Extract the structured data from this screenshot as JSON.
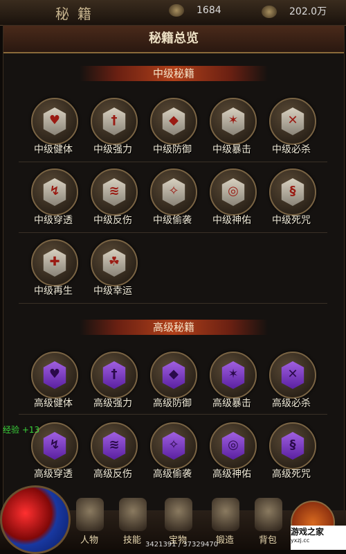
{
  "topbar": {
    "title": "秘籍",
    "resource1": "1684",
    "resource2": "202.0万"
  },
  "header": {
    "title": "秘籍总览"
  },
  "sections": {
    "mid": {
      "title": "中级秘籍"
    },
    "high": {
      "title": "高级秘籍"
    }
  },
  "mid_skills": [
    {
      "label": "中级健体",
      "icon": "heart-shield-icon"
    },
    {
      "label": "中级强力",
      "icon": "sword-icon"
    },
    {
      "label": "中级防御",
      "icon": "shield-icon"
    },
    {
      "label": "中级暴击",
      "icon": "burst-icon"
    },
    {
      "label": "中级必杀",
      "icon": "slash-icon"
    },
    {
      "label": "中级穿透",
      "icon": "pierce-icon"
    },
    {
      "label": "中级反伤",
      "icon": "reflect-icon"
    },
    {
      "label": "中级偷袭",
      "icon": "sneak-icon"
    },
    {
      "label": "中级神佑",
      "icon": "blessing-icon"
    },
    {
      "label": "中级死咒",
      "icon": "curse-icon"
    },
    {
      "label": "中级再生",
      "icon": "regen-icon"
    },
    {
      "label": "中级幸运",
      "icon": "luck-icon"
    }
  ],
  "high_skills": [
    {
      "label": "高级健体",
      "icon": "heart-shield-icon"
    },
    {
      "label": "高级强力",
      "icon": "sword-icon"
    },
    {
      "label": "高级防御",
      "icon": "shield-icon"
    },
    {
      "label": "高级暴击",
      "icon": "burst-icon"
    },
    {
      "label": "高级必杀",
      "icon": "slash-icon"
    },
    {
      "label": "高级穿透",
      "icon": "pierce-icon"
    },
    {
      "label": "高级反伤",
      "icon": "reflect-icon"
    },
    {
      "label": "高级偷袭",
      "icon": "sneak-icon"
    },
    {
      "label": "高级神佑",
      "icon": "blessing-icon"
    },
    {
      "label": "高级死咒",
      "icon": "curse-icon"
    }
  ],
  "exp_toast": "经验 +13",
  "nav": [
    {
      "label": "人物"
    },
    {
      "label": "技能"
    },
    {
      "label": "宝物"
    },
    {
      "label": "锻造"
    },
    {
      "label": "背包"
    }
  ],
  "xp_text": "3421391 / 37329470",
  "watermark": {
    "main": "游戏之家",
    "sub": "yxzj.cc"
  }
}
